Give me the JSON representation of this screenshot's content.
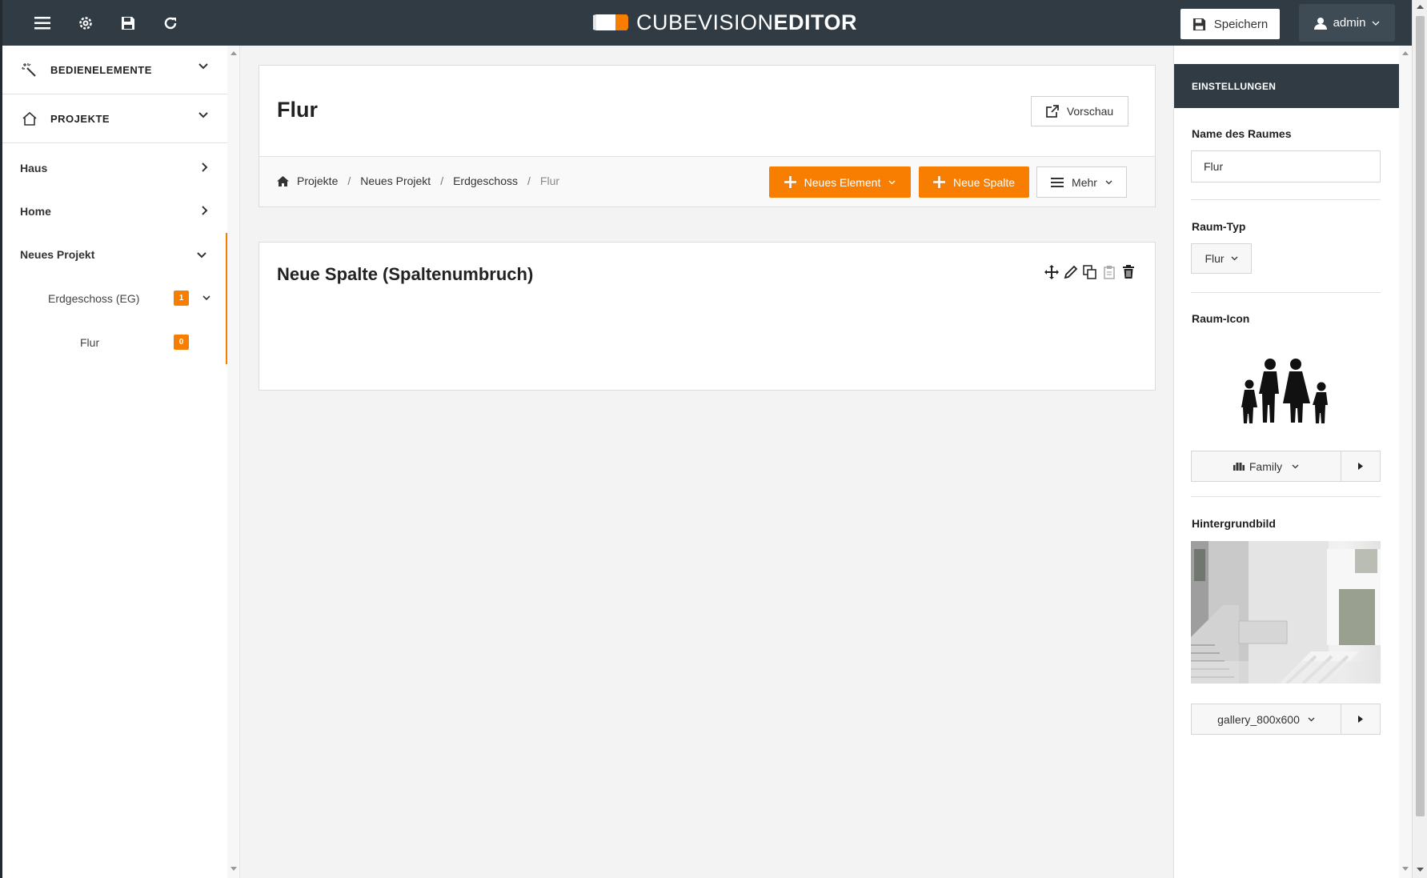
{
  "topbar": {
    "logo_thin": "CUBEVISION",
    "logo_bold": "EDITOR",
    "save_label": "Speichern",
    "user_label": "admin"
  },
  "sidebar": {
    "sections": [
      {
        "label": "BEDIENELEMENTE"
      },
      {
        "label": "PROJEKTE"
      }
    ],
    "items": [
      {
        "label": "Haus"
      },
      {
        "label": "Home"
      },
      {
        "label": "Neues Projekt"
      }
    ],
    "sub_items": [
      {
        "label": "Erdgeschoss (EG)",
        "badge": "1"
      },
      {
        "label": "Flur",
        "badge": "0"
      }
    ]
  },
  "main": {
    "title": "Flur",
    "preview_label": "Vorschau",
    "breadcrumb": [
      "Projekte",
      "Neues Projekt",
      "Erdgeschoss",
      "Flur"
    ],
    "new_element_label": "Neues Element",
    "new_column_label": "Neue Spalte",
    "more_label": "Mehr",
    "column_title": "Neue Spalte (Spaltenumbruch)"
  },
  "settings": {
    "header": "EINSTELLUNGEN",
    "room_name_label": "Name des Raumes",
    "room_name_value": "Flur",
    "room_type_label": "Raum-Typ",
    "room_type_value": "Flur",
    "room_icon_label": "Raum-Icon",
    "room_icon_value": "Family",
    "background_label": "Hintergrundbild",
    "background_value": "gallery_800x600"
  },
  "colors": {
    "accent": "#f77e00",
    "topbar": "#303b44"
  }
}
